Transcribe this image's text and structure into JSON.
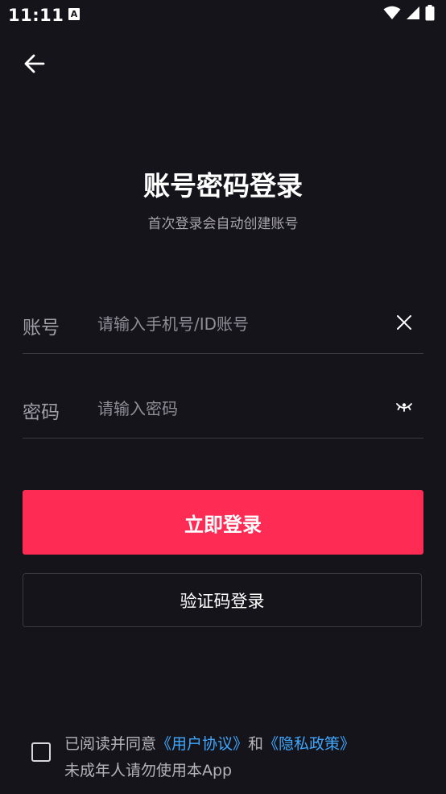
{
  "status_bar": {
    "time": "11:11",
    "notification_icon_letter": "A",
    "icons": [
      "wifi-icon",
      "signal-icon",
      "battery-icon"
    ]
  },
  "header": {
    "back_icon": "arrow-left-icon"
  },
  "title": "账号密码登录",
  "subtitle": "首次登录会自动创建账号",
  "form": {
    "account": {
      "label": "账号",
      "placeholder": "请输入手机号/ID账号",
      "value": "",
      "action_icon": "close-icon"
    },
    "password": {
      "label": "密码",
      "placeholder": "请输入密码",
      "value": "",
      "action_icon": "eye-closed-icon"
    }
  },
  "buttons": {
    "login": "立即登录",
    "code_login": "验证码登录"
  },
  "agreement": {
    "checked": false,
    "prefix": "已阅读并同意",
    "user_agreement": "《用户协议》",
    "and": "和",
    "privacy_policy": "《隐私政策》",
    "minor_notice": "未成年人请勿使用本App"
  },
  "colors": {
    "background": "#16141b",
    "accent": "#fe2c55",
    "link": "#3ea8ff",
    "divider": "#3a3840"
  }
}
